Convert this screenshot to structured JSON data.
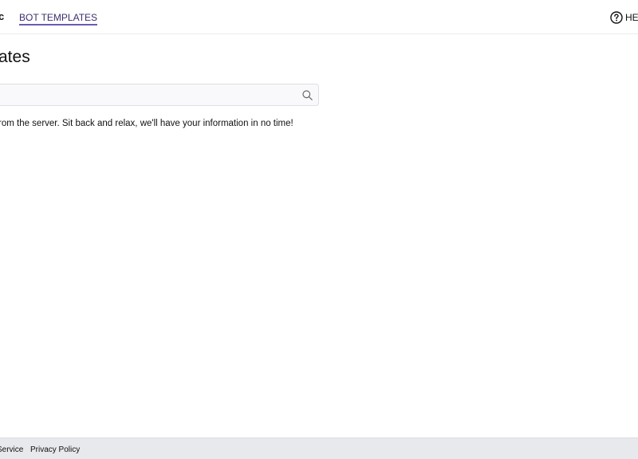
{
  "header": {
    "logo_text": "c",
    "nav_tab_label": "BOT TEMPLATES",
    "help_label": "HEI"
  },
  "main": {
    "title": "ates",
    "search": {
      "value": "",
      "placeholder": ""
    },
    "loading_message": "rom the server. Sit back and relax, we'll have your information in no time!"
  },
  "footer": {
    "terms_label": "Service",
    "privacy_label": "Privacy Policy"
  },
  "colors": {
    "nav_underline": "#6b5bb5",
    "footer_bg": "#e8e9ec",
    "search_bg": "#f9f9fb"
  },
  "icons": {
    "help": "question-circle-icon",
    "search": "magnifier-search-icon"
  }
}
